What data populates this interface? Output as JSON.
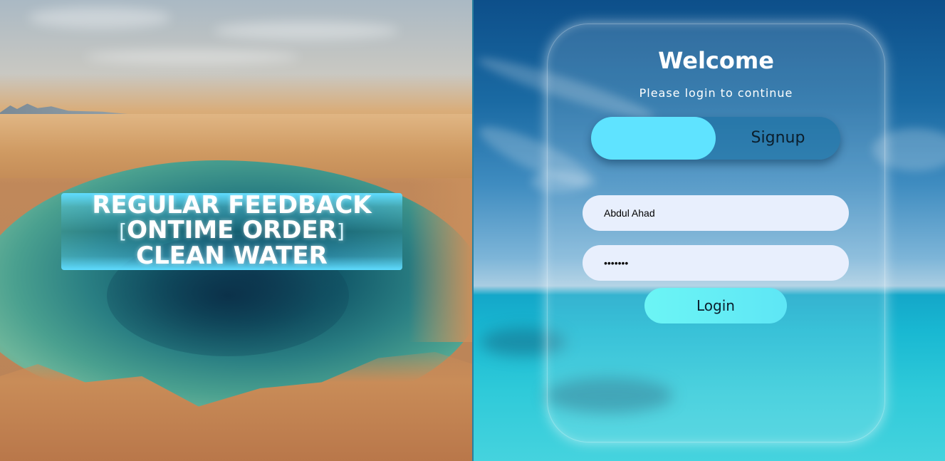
{
  "hero": {
    "lines": [
      "REGULAR FEEDBACK",
      "ONTIME ORDER",
      "CLEAN WATER"
    ],
    "bracket_left": "[",
    "bracket_right": "]"
  },
  "login": {
    "title": "Welcome",
    "subtitle": "Please login to continue",
    "toggle": {
      "active_label": "",
      "inactive_label": "Signup"
    },
    "username": {
      "value": "Abdul Ahad",
      "placeholder": ""
    },
    "password": {
      "value": "•••••••",
      "placeholder": ""
    },
    "submit_label": "Login"
  },
  "colors": {
    "accent": "#5fe3ff",
    "button": "#6cf5f5",
    "input_bg": "#e8effd"
  }
}
